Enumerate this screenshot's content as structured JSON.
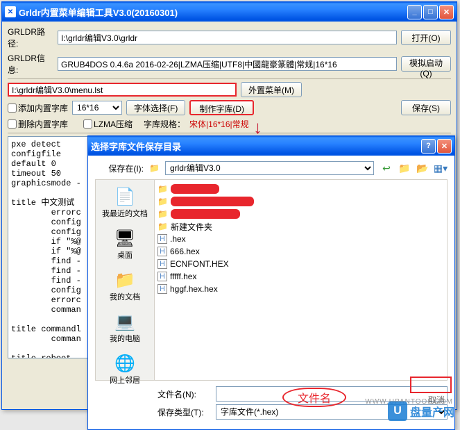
{
  "main": {
    "title": "Grldr内置菜单编辑工具V3.0(20160301)",
    "path_label": "GRLDR路径:",
    "path_value": "I:\\grldr编辑V3.0\\grldr",
    "info_label": "GRLDR信息:",
    "info_value": "GRUB4DOS 0.4.6a 2016-02-26|LZMA压缩|UTF8|中國龍豪篆體|常规|16*16",
    "open_btn": "打开(O)",
    "sim_btn": "模拟启动(Q)",
    "menu_path": "I:\\grldr编辑V3.0\\menu.lst",
    "ext_menu_btn": "外置菜单(M)",
    "add_font_chk": "添加内置字库",
    "font_size_combo": "16*16",
    "font_sel_btn": "字体选择(F)",
    "make_font_btn": "制作字库(D)",
    "save_btn": "保存(S)",
    "del_font_chk": "删除内置字库",
    "lzma_chk": "LZMA压缩",
    "font_spec_label": "字库规格：",
    "font_spec_value": "宋体|16*16|常规",
    "editor_text": "pxe detect\nconfigfile\ndefault 0\ntimeout 50\ngraphicsmode -\n\ntitle 中文测试\n        errorc\n        config\n        config\n        if \"%@\n        if \"%@\n        find -\n        find -\n        find -\n        config\n        errorc\n        comman\n\ntitle commandl\n        comman\n\ntitle reboot\n        reboot\n\ntitle halt\n        halt"
  },
  "dlg": {
    "title": "选择字库文件保存目录",
    "savein_label": "保存在(I):",
    "savein_value": "grldr编辑V3.0",
    "places": {
      "recent": "我最近的文档",
      "desktop": "桌面",
      "mydocs": "我的文档",
      "mycomp": "我的电脑",
      "network": "网上邻居"
    },
    "files": {
      "newfolder": "新建文件夹",
      "f1": ".hex",
      "f2": "666.hex",
      "f3": "ECNFONT.HEX",
      "f4": "fffff.hex",
      "f5": "hggf.hex.hex"
    },
    "fname_label": "文件名(N):",
    "fname_hint": "文件名",
    "ftype_label": "保存类型(T):",
    "ftype_value": "字库文件(*.hex)",
    "cancel": "取消"
  },
  "watermark": {
    "text": "盘量产网",
    "url": "WWW.UPANTOOL.COM"
  }
}
